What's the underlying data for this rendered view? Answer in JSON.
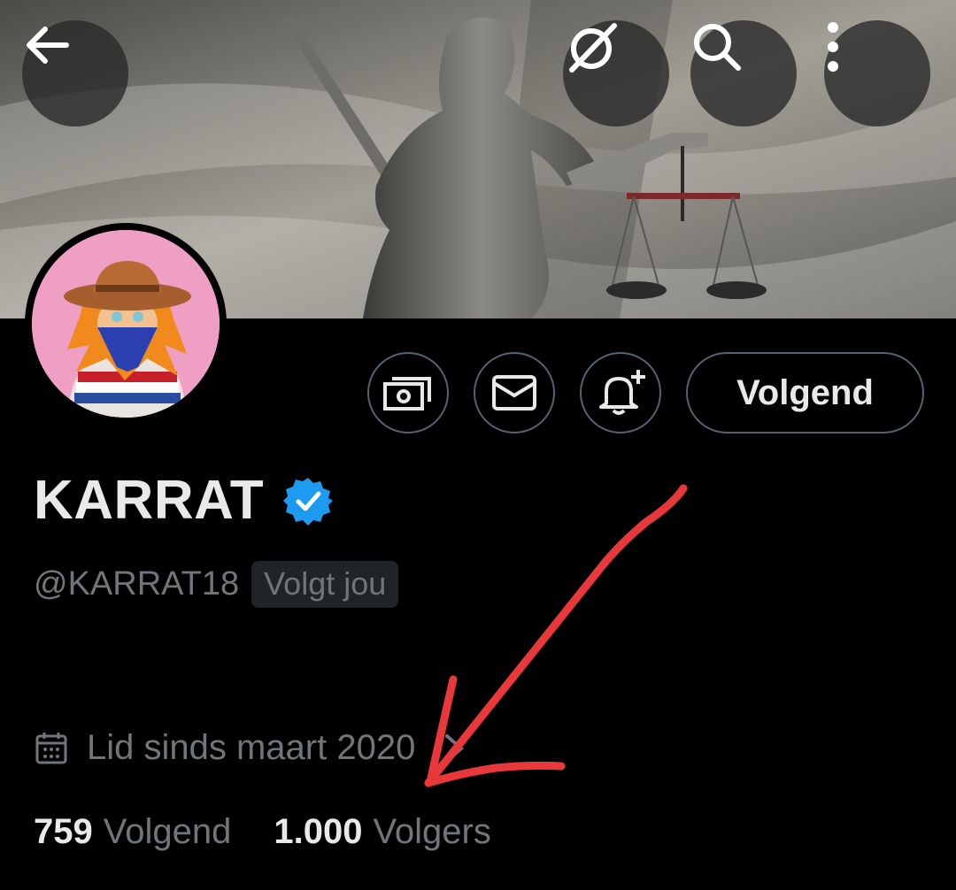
{
  "profile": {
    "display_name": "KARRAT",
    "handle": "@KARRAT18",
    "follows_you_badge": "Volgt jou",
    "joined": "Lid sinds maart 2020",
    "verified": true
  },
  "actions": {
    "follow_label": "Volgend"
  },
  "stats": {
    "following_count": "759",
    "following_label": "Volgend",
    "followers_count": "1.000",
    "followers_label": "Volgers"
  },
  "icons": {
    "back": "arrow-left-icon",
    "grok": "grok-icon",
    "search": "search-icon",
    "more": "more-vertical-icon",
    "subscribe": "money-icon",
    "message": "envelope-icon",
    "notify": "bell-plus-icon",
    "verified": "verified-badge-icon",
    "calendar": "calendar-icon",
    "chevron": "chevron-right-icon"
  },
  "colors": {
    "background": "#000000",
    "primary_text": "#e7e9ea",
    "secondary_text": "#71767b",
    "border": "#536471",
    "verified_blue": "#1d9bf0",
    "annotation_red": "#e8383a",
    "avatar_bg": "#f09fc4"
  }
}
